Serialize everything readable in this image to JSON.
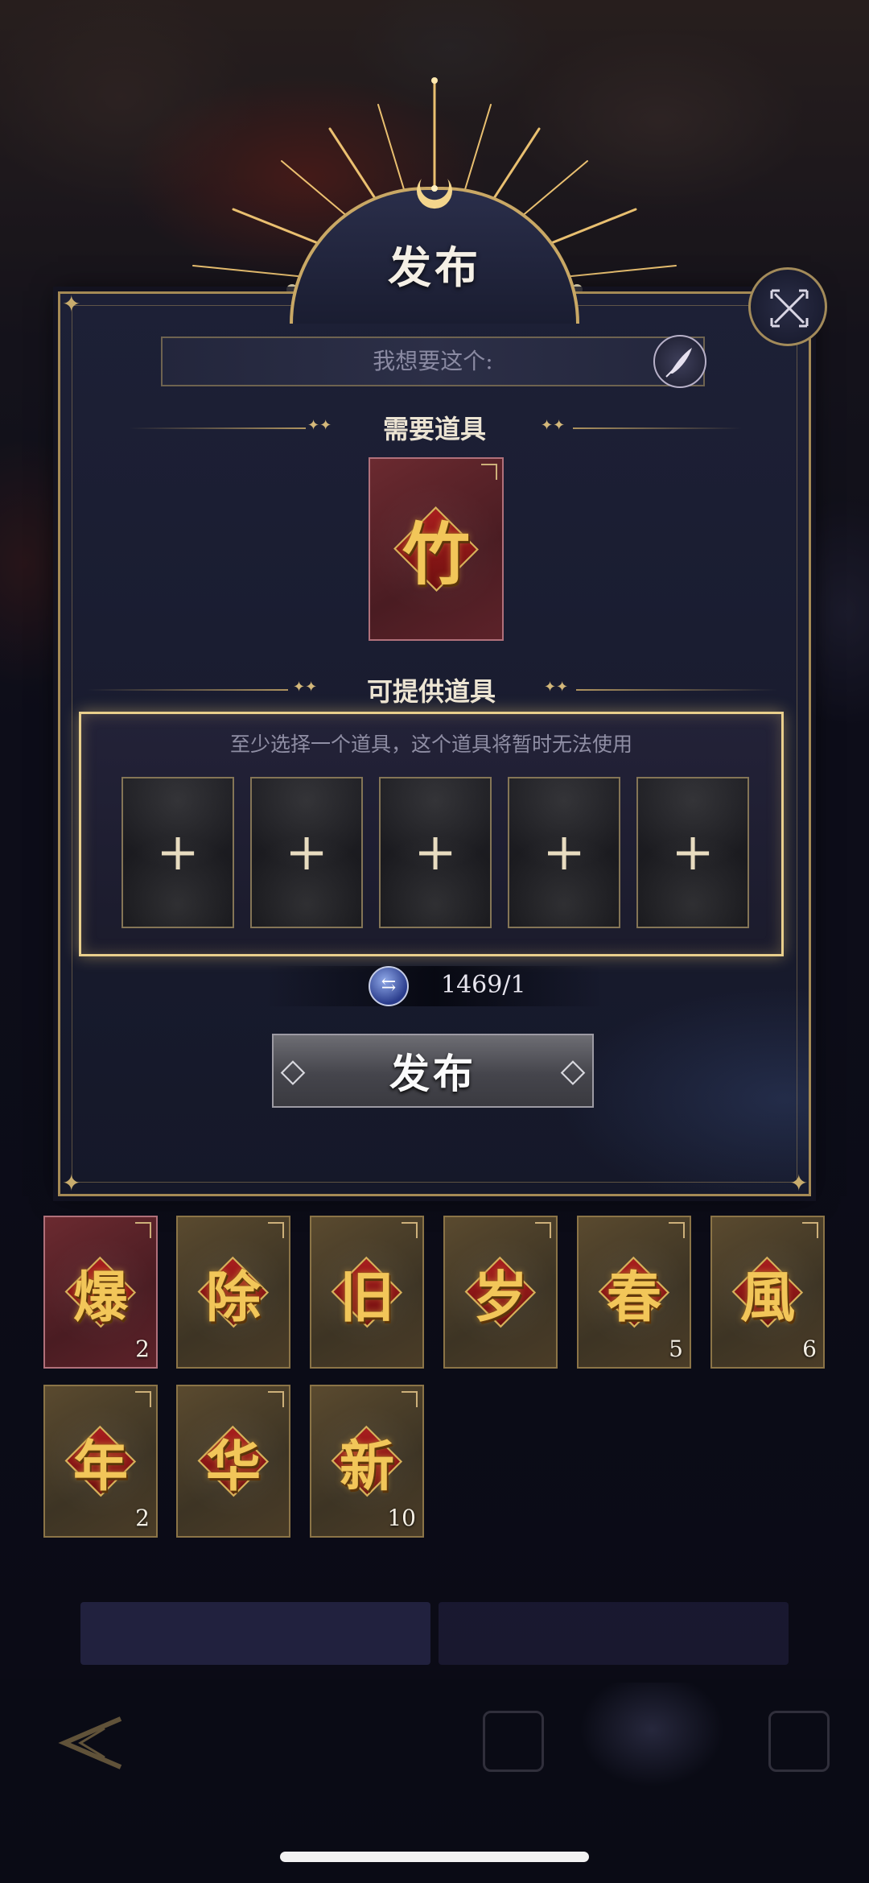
{
  "dialog": {
    "title": "发布",
    "wish_placeholder": "我想要这个:",
    "required_section_label": "需要道具",
    "required_item": {
      "char": "竹",
      "style": "red"
    },
    "offer_section_label": "可提供道具",
    "offer_hint": "至少选择一个道具，这个道具将暂时无法使用",
    "offer_slots": [
      "+",
      "+",
      "+",
      "+",
      "+"
    ],
    "currency_text": "1469/1",
    "currency_icon": "exchange-coin-icon",
    "publish_label": "发布"
  },
  "inventory": [
    {
      "char": "爆",
      "count": "2",
      "style": "red"
    },
    {
      "char": "除",
      "count": "",
      "style": "gold"
    },
    {
      "char": "旧",
      "count": "",
      "style": "gold"
    },
    {
      "char": "岁",
      "count": "",
      "style": "gold"
    },
    {
      "char": "春",
      "count": "5",
      "style": "gold"
    },
    {
      "char": "風",
      "count": "6",
      "style": "gold"
    },
    {
      "char": "年",
      "count": "2",
      "style": "gold"
    },
    {
      "char": "华",
      "count": "",
      "style": "gold"
    },
    {
      "char": "新",
      "count": "10",
      "style": "gold"
    }
  ],
  "colors": {
    "gold_accent": "#c9a865",
    "panel_bg": "#1b1e32",
    "card_red": "#6b2a30",
    "card_gold": "#5a4a2f"
  }
}
